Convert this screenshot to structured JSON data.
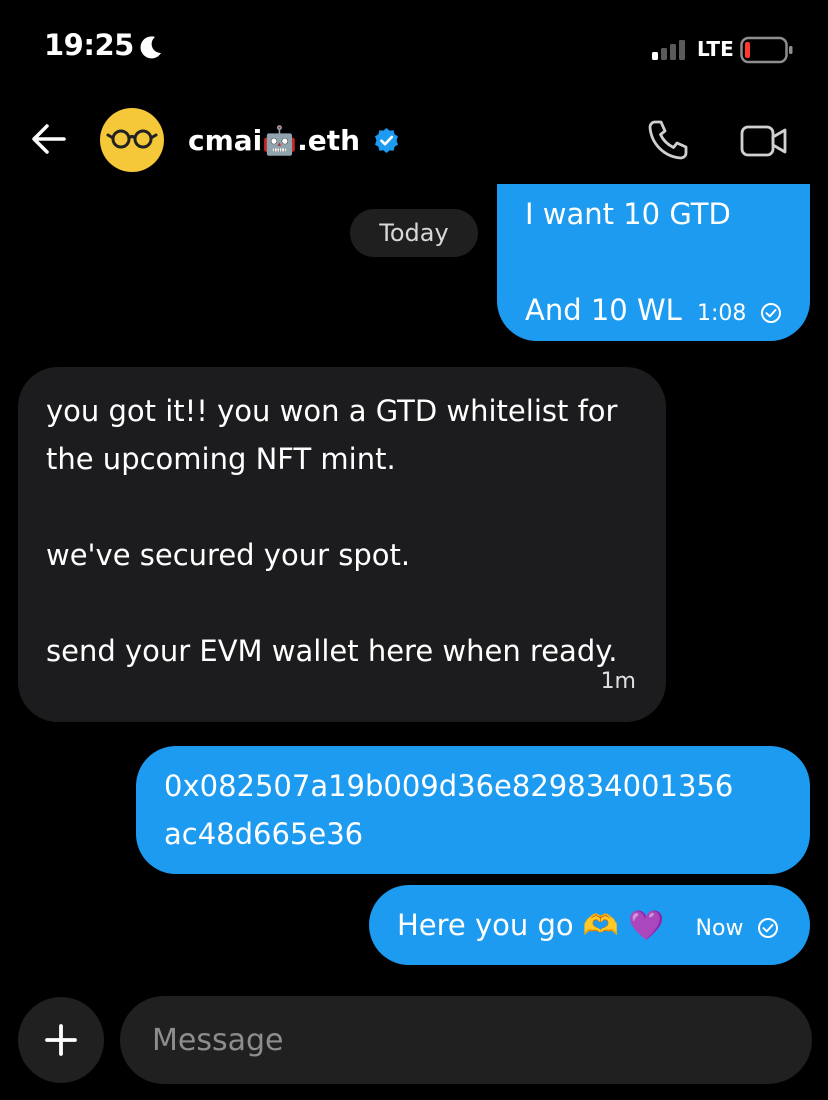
{
  "status_bar": {
    "time": "19:25",
    "network": "LTE"
  },
  "header": {
    "contact_name": "cmai",
    "name_emoji": "🤖",
    "name_suffix": ".eth"
  },
  "conversation": {
    "date_separator": "Today",
    "messages": [
      {
        "direction": "sent",
        "lines": [
          "I want 10 GTD",
          "",
          "And 10 WL"
        ],
        "time": "1:08",
        "status": "read"
      },
      {
        "direction": "received",
        "lines": [
          "you got it!! you won a GTD whitelist for",
          "the upcoming NFT mint.",
          "",
          "we've secured your spot.",
          "",
          "send your EVM wallet here when ready."
        ],
        "time": "1m"
      },
      {
        "direction": "sent",
        "lines": [
          "0x082507a19b009d36e829834001356",
          "ac48d665e36"
        ]
      },
      {
        "direction": "sent",
        "text": "Here you go 🫶 💜",
        "time": "Now",
        "status": "read"
      }
    ]
  },
  "composer": {
    "placeholder": "Message"
  },
  "colors": {
    "accent": "#1d9bf0",
    "received_bubble": "#1c1c1e",
    "background": "#000000",
    "avatar_bg": "#f5c83a",
    "battery_low": "#ff3b30"
  },
  "icons": [
    "moon-icon",
    "signal-icon",
    "battery-icon",
    "back-arrow-icon",
    "verified-badge-icon",
    "phone-icon",
    "video-camera-icon",
    "read-check-icon",
    "plus-icon"
  ]
}
